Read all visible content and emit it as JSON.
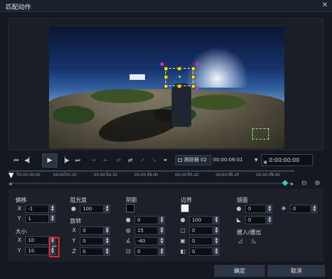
{
  "window": {
    "title": "匹配动作",
    "close_icon": "close-icon"
  },
  "playback": {
    "buttons": [
      "go-to-start",
      "previous-frame",
      "play",
      "next-frame",
      "go-to-end"
    ],
    "tracker_select": "跟踪器 02",
    "tracker_time": "00:00:06:01",
    "current_time": "0:00:00:00"
  },
  "timeline": {
    "ticks": [
      "00:00:00:00",
      "00:00:01:10",
      "00:00:02:20",
      "00:00:04:00",
      "00:00:05:10",
      "00:00:06:20",
      "00:00:08:00"
    ]
  },
  "offset": {
    "label": "偏移",
    "x_label": "X",
    "x": "-1",
    "y_label": "Y",
    "y": "1"
  },
  "size": {
    "label": "大小",
    "x_label": "X",
    "x": "10",
    "y_label": "Y",
    "y": "10"
  },
  "opacity": {
    "label": "阻光度",
    "value": "100"
  },
  "rotation": {
    "label": "旋转",
    "x_label": "X",
    "x": "0",
    "y_label": "Y",
    "y": "0",
    "z_label": "Z",
    "z": "0"
  },
  "shadow": {
    "label": "阴影",
    "color": "#000000",
    "opacity": "0",
    "blur": "15",
    "angle": "-40",
    "distance": "0"
  },
  "border": {
    "label": "边界",
    "color": "#ffffff",
    "opacity": "100",
    "width": "0",
    "a": "0",
    "b": "0"
  },
  "mirror": {
    "label": "镜面",
    "opacity": "0",
    "distance": "0",
    "gradient": "0"
  },
  "ease": {
    "label": "缓入/缓出"
  },
  "dialog": {
    "ok": "确定",
    "cancel": "取消"
  }
}
